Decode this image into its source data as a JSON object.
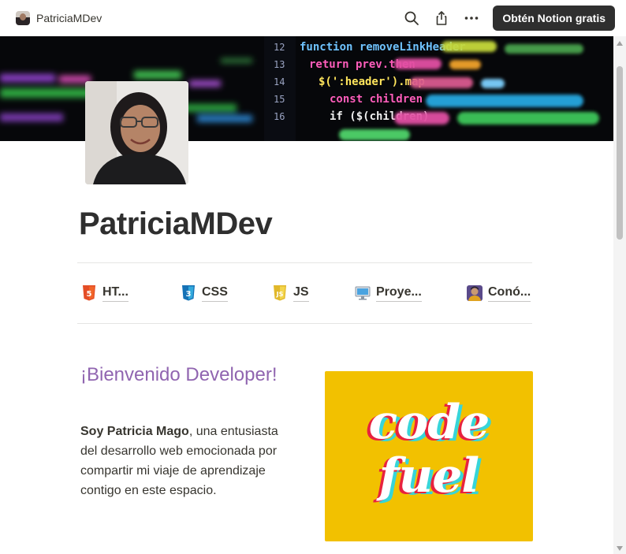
{
  "topbar": {
    "site_name": "PatriciaMDev",
    "search_icon": "search-icon",
    "share_icon": "share-icon",
    "more_icon": "more-icon",
    "cta_label": "Obtén Notion gratis"
  },
  "page": {
    "title": "PatriciaMDev"
  },
  "links": [
    {
      "label": "HT...",
      "icon": "html5-icon"
    },
    {
      "label": "CSS",
      "icon": "css3-icon"
    },
    {
      "label": "JS",
      "icon": "js-icon"
    },
    {
      "label": "Proye...",
      "icon": "computer-icon"
    },
    {
      "label": "Conó...",
      "icon": "person-icon"
    }
  ],
  "intro": {
    "heading": "¡Bienvenido Developer!",
    "name": "Soy Patricia Mago",
    "text": ", una entusiasta del desarrollo web emocionada por compartir mi viaje de aprendizaje contigo en este espacio."
  },
  "banner": {
    "line1": "code",
    "line2": "fuel"
  },
  "cover_code": {
    "line_numbers": [
      "12",
      "13",
      "14",
      "15",
      "16"
    ],
    "line1": "function removeLinkHeader",
    "line2": "return prev.then",
    "line3": "$(':header').map",
    "line4": "const children",
    "line5": "if ($(children)"
  },
  "colors": {
    "accent_purple": "#9065b0",
    "banner_yellow": "#f2c100",
    "cta_dark": "#2f2f2f"
  }
}
